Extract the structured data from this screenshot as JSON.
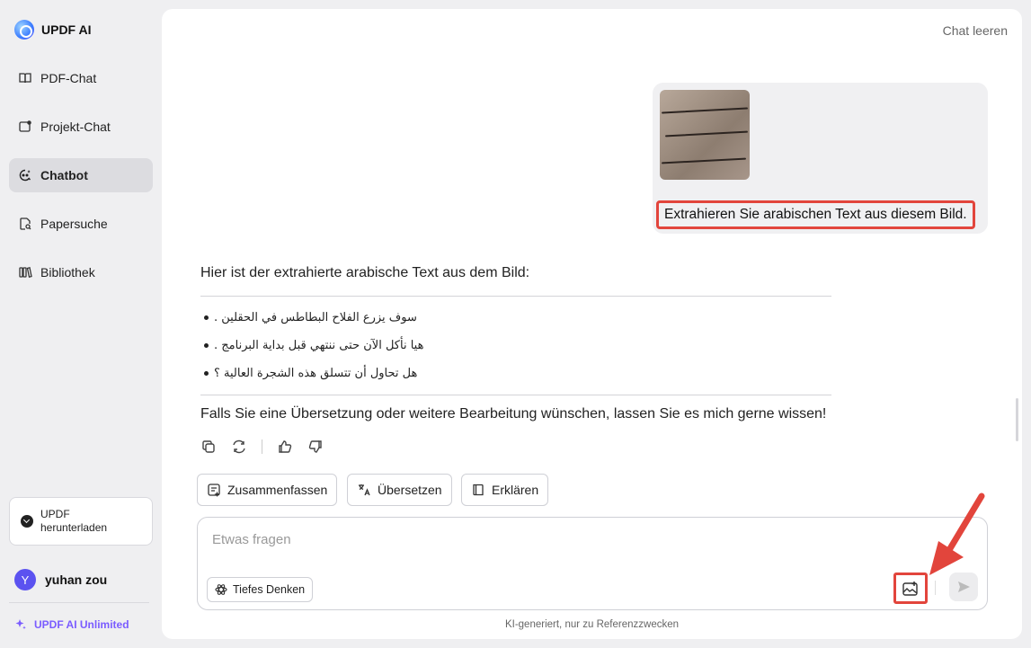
{
  "brand": {
    "name": "UPDF AI"
  },
  "sidebar": {
    "items": [
      {
        "label": "PDF-Chat",
        "icon": "book-open-icon"
      },
      {
        "label": "Projekt-Chat",
        "icon": "folder-chat-icon"
      },
      {
        "label": "Chatbot",
        "icon": "chatbot-icon",
        "active": true
      },
      {
        "label": "Papersuche",
        "icon": "paper-search-icon"
      },
      {
        "label": "Bibliothek",
        "icon": "library-icon"
      }
    ],
    "download_label": "UPDF herunterladen",
    "user": {
      "initial": "Y",
      "name": "yuhan zou"
    },
    "unlimited_label": "UPDF AI Unlimited"
  },
  "header": {
    "clear_chat": "Chat leeren"
  },
  "chat": {
    "user_message": "Extrahieren Sie arabischen Text aus diesem Bild.",
    "answer_intro": "Hier ist der extrahierte arabische Text aus dem Bild:",
    "arabic_lines": [
      "سوف يزرع الفلاح البطاطس في الحقلين .",
      "هيا نأكل الآن حتى ننتهي قبل بداية البرنامج .",
      "هل تحاول أن تتسلق هذه الشجرة العالية ؟"
    ],
    "answer_outro": "Falls Sie eine Übersetzung oder weitere Bearbeitung wünschen, lassen Sie es mich gerne wissen!"
  },
  "quick_actions": [
    {
      "label": "Zusammenfassen",
      "icon": "summarize-icon"
    },
    {
      "label": "Übersetzen",
      "icon": "translate-icon"
    },
    {
      "label": "Erklären",
      "icon": "explain-icon"
    }
  ],
  "composer": {
    "placeholder": "Etwas fragen",
    "deep_think_label": "Tiefes Denken"
  },
  "footnote": "KI-generiert, nur zu Referenzzwecken",
  "colors": {
    "accent": "#7a5cff",
    "highlight": "#e2453c",
    "avatar": "#5b52f0"
  }
}
